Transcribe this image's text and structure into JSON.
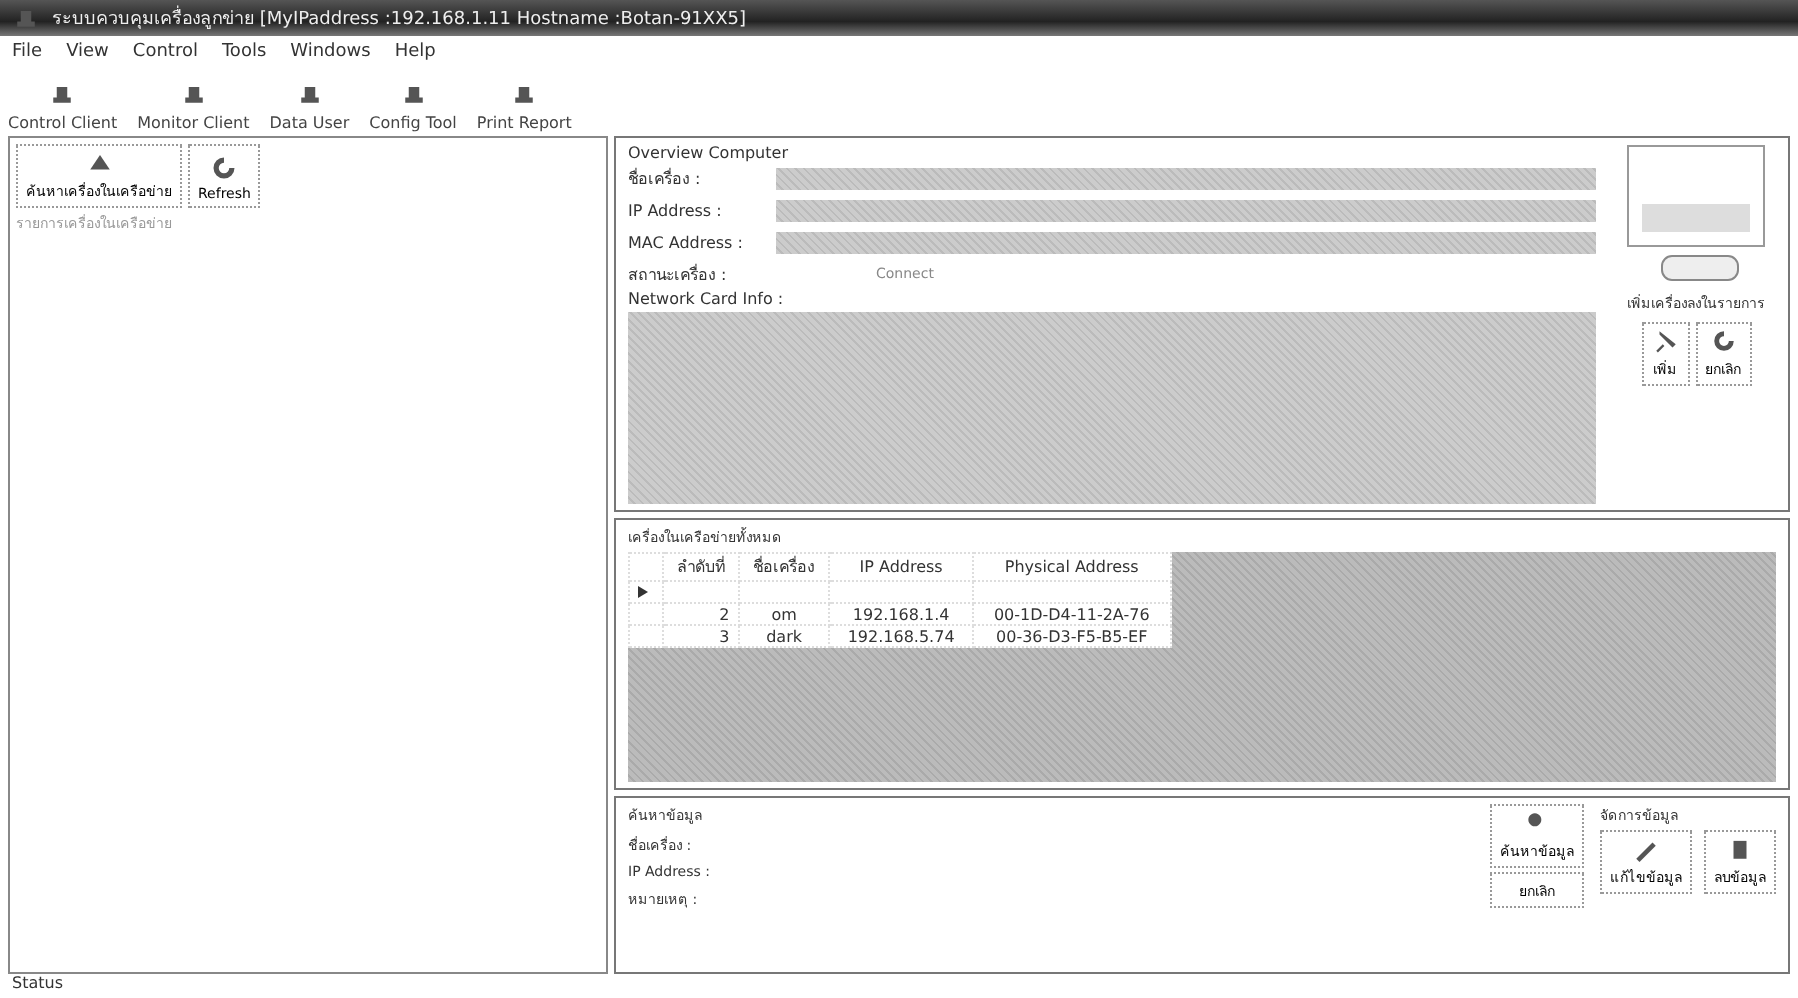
{
  "window": {
    "title": "ระบบควบคุมเครื่องลูกข่าย [MyIPaddress :192.168.1.11 Hostname :Botan-91XX5]"
  },
  "menu": [
    "File",
    "View",
    "Control",
    "Tools",
    "Windows",
    "Help"
  ],
  "toolbar": [
    "Control Client",
    "Monitor Client",
    "Data User",
    "Config Tool",
    "Print Report"
  ],
  "left_panel": {
    "buttons": [
      "ค้นหาเครื่องในเครือข่าย",
      "Refresh"
    ],
    "caption": "รายการเครื่องในเครือข่าย"
  },
  "overview": {
    "title": "Overview Computer",
    "fields": [
      {
        "label": "ชื่อเครื่อง :"
      },
      {
        "label": "IP Address :"
      },
      {
        "label": "MAC Address :"
      }
    ],
    "status_label": "สถานะเครื่อง :",
    "status_value": "Connect",
    "network_label": "Network Card Info :",
    "add_caption": "เพิ่มเครื่องลงในรายการ",
    "buttons": [
      "เพิ่ม",
      "ยกเลิก"
    ]
  },
  "grid": {
    "title": "เครื่องในเครือข่ายทั้งหมด",
    "columns": [
      "ลำดับที่",
      "ชื่อเครื่อง",
      "IP Address",
      "Physical Address"
    ],
    "rows": [
      {
        "cells": [
          "",
          "",
          "",
          ""
        ],
        "current": true
      },
      {
        "cells": [
          "2",
          "om",
          "192.168.1.4",
          "00-1D-D4-11-2A-76"
        ],
        "current": false
      },
      {
        "cells": [
          "3",
          "dark",
          "192.168.5.74",
          "00-36-D3-F5-B5-EF"
        ],
        "current": false
      }
    ]
  },
  "search": {
    "title": "ค้นหาข้อมูล",
    "labels": [
      "ชื่อเครื่อง :",
      "IP Address :",
      "หมายเหตุ :"
    ],
    "search_button": "ค้นหาข้อมูล",
    "cancel_button": "ยกเลิก",
    "manage_title": "จัดการข้อมูล",
    "manage_buttons": [
      "แก้ไขข้อมูล",
      "ลบข้อมูล"
    ]
  },
  "status_bar": "Status"
}
